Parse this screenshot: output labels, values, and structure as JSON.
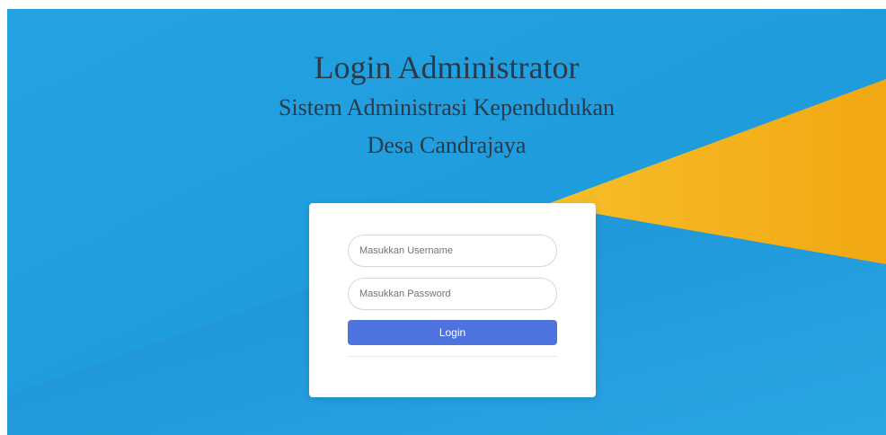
{
  "page": {
    "title": "Login Administrator",
    "subtitle_line1": "Sistem Administrasi Kependudukan",
    "subtitle_line2": "Desa Candrajaya"
  },
  "login_form": {
    "username_placeholder": "Masukkan Username",
    "username_value": "",
    "password_placeholder": "Masukkan Password",
    "password_value": "",
    "login_label": "Login"
  },
  "colors": {
    "background_blue": "#1f9ddf",
    "accent_yellow": "#f4b21c",
    "button_primary": "#4e73df",
    "heading_text": "#2a3a4a"
  }
}
